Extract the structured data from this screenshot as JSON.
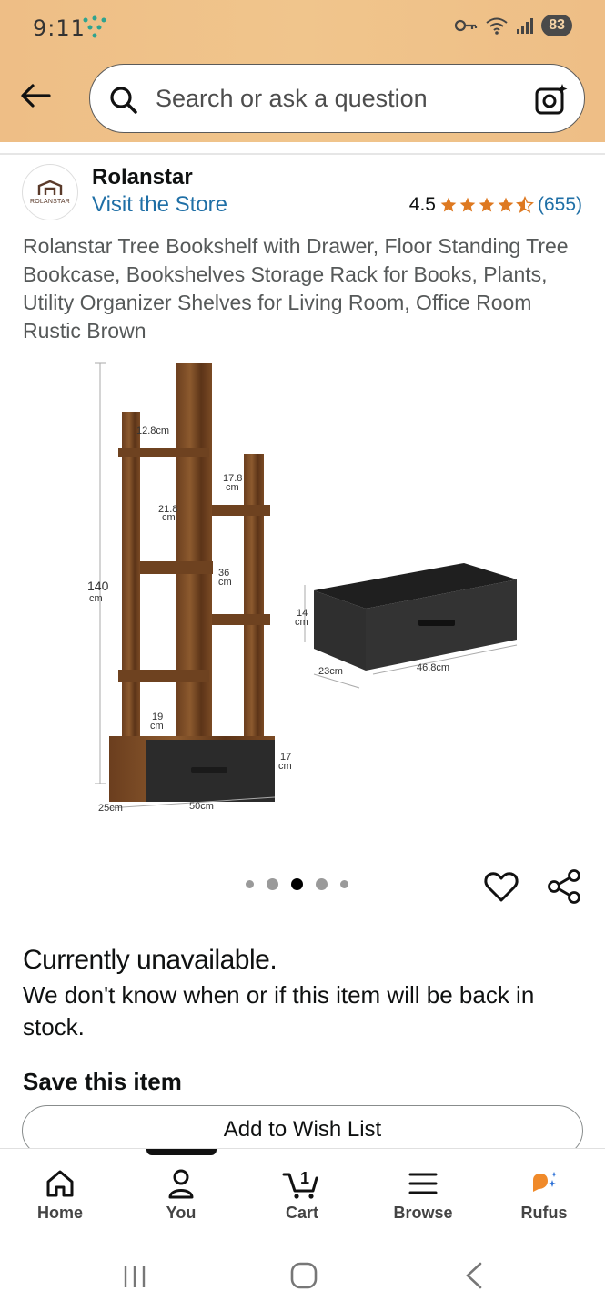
{
  "status_bar": {
    "time": "9:11",
    "battery": "83"
  },
  "search": {
    "placeholder": "Search or ask a question"
  },
  "brand": {
    "logo_text": "ROLANSTAR",
    "name": "Rolanstar",
    "visit_store": "Visit the Store"
  },
  "rating": {
    "value": "4.5",
    "count": "(655)",
    "stars": 4.5
  },
  "product": {
    "title": "Rolanstar Tree Bookshelf with Drawer, Floor Standing Tree Bookcase, Bookshelves Storage Rack for Books, Plants, Utility Organizer Shelves for Living Room, Office Room Rustic Brown"
  },
  "image_labels": {
    "height": "140",
    "height_unit": "cm",
    "top_width": "12.8cm",
    "shelf_depth": "17.8",
    "shelf_depth_unit": "cm",
    "shelf_width": "21.8",
    "shelf_width_unit": "cm",
    "shelf_gap": "36",
    "shelf_gap_unit": "cm",
    "bottom_gap": "19",
    "bottom_gap_unit": "cm",
    "base_height": "17",
    "base_height_unit": "cm",
    "base_depth": "25cm",
    "base_width": "50cm",
    "drawer_height": "14",
    "drawer_height_unit": "cm",
    "drawer_depth": "23cm",
    "drawer_width": "46.8cm"
  },
  "carousel": {
    "count": 5,
    "active_index": 2
  },
  "availability": {
    "title": "Currently unavailable.",
    "description": "We don't know when or if this item will be back in stock."
  },
  "save": {
    "title": "Save this item",
    "wish_list_button": "Add to Wish List"
  },
  "bottom_nav": {
    "items": [
      {
        "label": "Home",
        "icon": "home-icon"
      },
      {
        "label": "You",
        "icon": "user-icon"
      },
      {
        "label": "Cart",
        "icon": "cart-icon",
        "badge": "1"
      },
      {
        "label": "Browse",
        "icon": "menu-icon"
      },
      {
        "label": "Rufus",
        "icon": "rufus-icon"
      }
    ]
  },
  "colors": {
    "header_bg": "#f0c58c",
    "link": "#1f6fa6",
    "star": "#de7921",
    "rufus_orange": "#f08a2a",
    "rufus_blue": "#2a6fd6"
  }
}
